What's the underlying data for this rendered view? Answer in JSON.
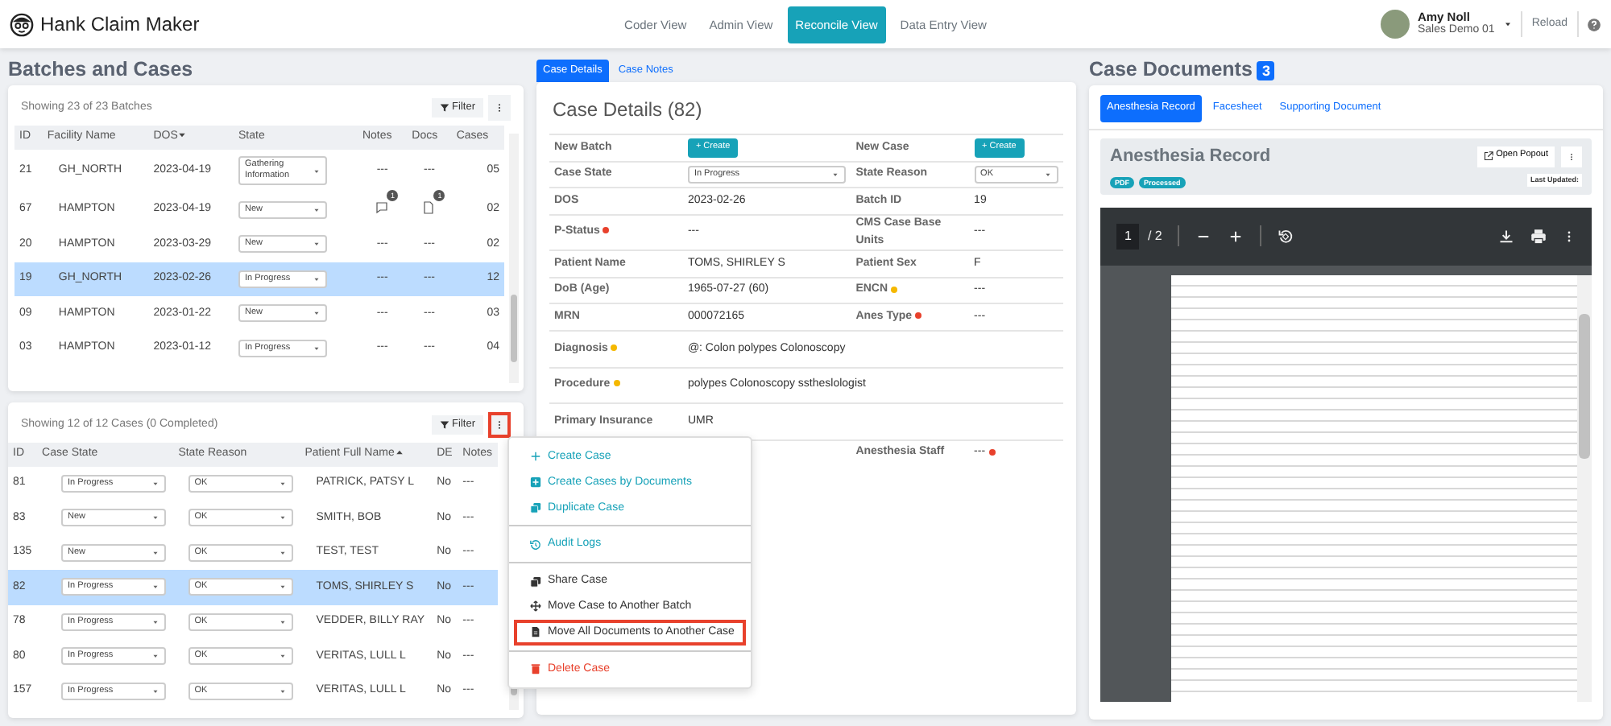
{
  "app": {
    "title": "Hank Claim Maker"
  },
  "nav_tabs": [
    {
      "label": "Coder View",
      "selected": false
    },
    {
      "label": "Admin View",
      "selected": false
    },
    {
      "label": "Reconcile View",
      "selected": true
    },
    {
      "label": "Data Entry View",
      "selected": false
    }
  ],
  "user": {
    "name": "Amy Noll",
    "org": "Sales Demo 01"
  },
  "reload_label": "Reload",
  "batches": {
    "title": "Batches and Cases",
    "summary": "Showing 23 of 23 Batches",
    "filter_label": "Filter",
    "columns": [
      {
        "label": "ID"
      },
      {
        "label": "Facility Name"
      },
      {
        "label": "DOS",
        "sorted": true,
        "ascending": false
      },
      {
        "label": "State"
      },
      {
        "label": "Notes"
      },
      {
        "label": "Docs"
      },
      {
        "label": "Cases"
      }
    ],
    "rows": [
      {
        "id": "21",
        "facility": "GH_NORTH",
        "dos": "2023-04-19",
        "state": "Gathering Information",
        "notes": {
          "kind": "text",
          "text": "---"
        },
        "docs": {
          "kind": "text",
          "text": "---"
        },
        "cases": "05",
        "selected": false
      },
      {
        "id": "67",
        "facility": "HAMPTON",
        "dos": "2023-04-19",
        "state": "New",
        "notes": {
          "kind": "icon",
          "count": "1"
        },
        "docs": {
          "kind": "icon",
          "count": "1"
        },
        "cases": "02",
        "selected": false
      },
      {
        "id": "20",
        "facility": "HAMPTON",
        "dos": "2023-03-29",
        "state": "New",
        "notes": {
          "kind": "text",
          "text": "---"
        },
        "docs": {
          "kind": "text",
          "text": "---"
        },
        "cases": "02",
        "selected": false
      },
      {
        "id": "19",
        "facility": "GH_NORTH",
        "dos": "2023-02-26",
        "state": "In Progress",
        "notes": {
          "kind": "text",
          "text": "---"
        },
        "docs": {
          "kind": "text",
          "text": "---"
        },
        "cases": "12",
        "selected": true
      },
      {
        "id": "09",
        "facility": "HAMPTON",
        "dos": "2023-01-22",
        "state": "New",
        "notes": {
          "kind": "text",
          "text": "---"
        },
        "docs": {
          "kind": "text",
          "text": "---"
        },
        "cases": "03",
        "selected": false
      },
      {
        "id": "03",
        "facility": "HAMPTON",
        "dos": "2023-01-12",
        "state": "In Progress",
        "notes": {
          "kind": "text",
          "text": "---"
        },
        "docs": {
          "kind": "text",
          "text": "---"
        },
        "cases": "04",
        "selected": false
      }
    ]
  },
  "cases": {
    "summary": "Showing 12 of 12 Cases (0 Completed)",
    "filter_label": "Filter",
    "menu_button_highlighted": true,
    "columns": [
      {
        "label": "ID"
      },
      {
        "label": "Case State"
      },
      {
        "label": "State Reason"
      },
      {
        "label": "Patient Full Name",
        "sorted": true,
        "ascending": true
      },
      {
        "label": "DE"
      },
      {
        "label": "Notes"
      }
    ],
    "rows": [
      {
        "id": "81",
        "state": "In Progress",
        "reason": "OK",
        "patient": "PATRICK, PATSY L",
        "de": "No",
        "notes": "---",
        "selected": false
      },
      {
        "id": "83",
        "state": "New",
        "reason": "OK",
        "patient": "SMITH, BOB",
        "de": "No",
        "notes": "---",
        "selected": false
      },
      {
        "id": "135",
        "state": "New",
        "reason": "OK",
        "patient": "TEST, TEST",
        "de": "No",
        "notes": "---",
        "selected": false
      },
      {
        "id": "82",
        "state": "In Progress",
        "reason": "OK",
        "patient": "TOMS, SHIRLEY S",
        "de": "No",
        "notes": "---",
        "selected": true
      },
      {
        "id": "78",
        "state": "In Progress",
        "reason": "OK",
        "patient": "VEDDER, BILLY RAY",
        "de": "No",
        "notes": "---",
        "selected": false
      },
      {
        "id": "80",
        "state": "In Progress",
        "reason": "OK",
        "patient": "VERITAS, LULL L",
        "de": "No",
        "notes": "---",
        "selected": false
      },
      {
        "id": "157",
        "state": "In Progress",
        "reason": "OK",
        "patient": "VERITAS, LULL L",
        "de": "No",
        "notes": "---",
        "selected": false
      }
    ]
  },
  "case_menu": [
    {
      "items": [
        {
          "label": "Create Case",
          "kind": "link",
          "highlighted": false
        },
        {
          "label": "Create Cases by Documents",
          "kind": "link",
          "highlighted": false
        },
        {
          "label": "Duplicate Case",
          "kind": "link",
          "highlighted": false
        }
      ]
    },
    {
      "items": [
        {
          "label": "Audit Logs",
          "kind": "link",
          "highlighted": false
        }
      ]
    },
    {
      "items": [
        {
          "label": "Share Case",
          "kind": "plain",
          "highlighted": false
        },
        {
          "label": "Move Case to Another Batch",
          "kind": "plain",
          "highlighted": false
        },
        {
          "label": "Move All Documents to Another Case",
          "kind": "plain",
          "highlighted": true
        }
      ]
    },
    {
      "items": [
        {
          "label": "Delete Case",
          "kind": "danger",
          "highlighted": false
        }
      ]
    }
  ],
  "detail_tabs": [
    {
      "label": "Case Details",
      "selected": true
    },
    {
      "label": "Case Notes",
      "selected": false
    }
  ],
  "case_details": {
    "title": "Case Details (82)",
    "rows": [
      {
        "cells": [
          {
            "label": "New Batch",
            "kind": "button",
            "value": "+ Create"
          },
          {
            "label": "New Case",
            "kind": "button",
            "value": "+ Create"
          }
        ]
      },
      {
        "cells": [
          {
            "label": "Case State",
            "kind": "select",
            "value": "In Progress"
          },
          {
            "label": "State Reason",
            "kind": "select",
            "value": "OK"
          }
        ]
      },
      {
        "cells": [
          {
            "label": "DOS",
            "kind": "text",
            "value": "2023-02-26"
          },
          {
            "label": "Batch ID",
            "kind": "text",
            "value": "19"
          }
        ]
      },
      {
        "cells": [
          {
            "label": "P-Status",
            "color": "#e8412c",
            "kind": "text",
            "value": "---"
          },
          {
            "label": "CMS Case Base Units",
            "kind": "text",
            "value": "---"
          }
        ]
      },
      {
        "cells": [
          {
            "label": "Patient Name",
            "kind": "text",
            "value": "TOMS, SHIRLEY S"
          },
          {
            "label": "Patient Sex",
            "kind": "text",
            "value": "F"
          }
        ]
      },
      {
        "cells": [
          {
            "label": "DoB (Age)",
            "kind": "text",
            "value": "1965-07-27 (60)"
          },
          {
            "label": "ENCN",
            "color": "#f5b800",
            "kind": "text",
            "value": "---"
          }
        ]
      },
      {
        "cells": [
          {
            "label": "MRN",
            "kind": "text",
            "value": "000072165"
          },
          {
            "label": "Anes Type",
            "color": "#e8412c",
            "kind": "text",
            "value": "---"
          }
        ]
      },
      {
        "cells": [
          {
            "label": "Diagnosis",
            "color": "#f5b800",
            "kind": "text",
            "value": "@: Colon polypes Colonoscopy"
          }
        ]
      },
      {
        "cells": [
          {
            "label": "Procedure",
            "color": "#f5b800",
            "kind": "text",
            "value": "polypes Colonoscopy sstheslologist"
          }
        ]
      },
      {
        "cells": [
          {
            "label": "Primary Insurance",
            "kind": "text",
            "value": "UMR"
          }
        ]
      },
      {
        "cells": [
          null,
          {
            "label": "Anesthesia Staff",
            "kind": "text",
            "value": "---",
            "value_dot": {
              "color": "#e8412c"
            }
          }
        ]
      }
    ]
  },
  "documents": {
    "title": "Case Documents",
    "count": "3",
    "tabs": [
      {
        "label": "Anesthesia Record",
        "selected": true
      },
      {
        "label": "Facesheet",
        "selected": false
      },
      {
        "label": "Supporting Document",
        "selected": false
      }
    ],
    "doc_title": "Anesthesia Record",
    "badges": [
      "PDF",
      "Processed"
    ],
    "popout_label": "Open Popout",
    "last_updated": "Last Updated:",
    "viewer": {
      "page": "1",
      "total": "/ 2"
    }
  }
}
